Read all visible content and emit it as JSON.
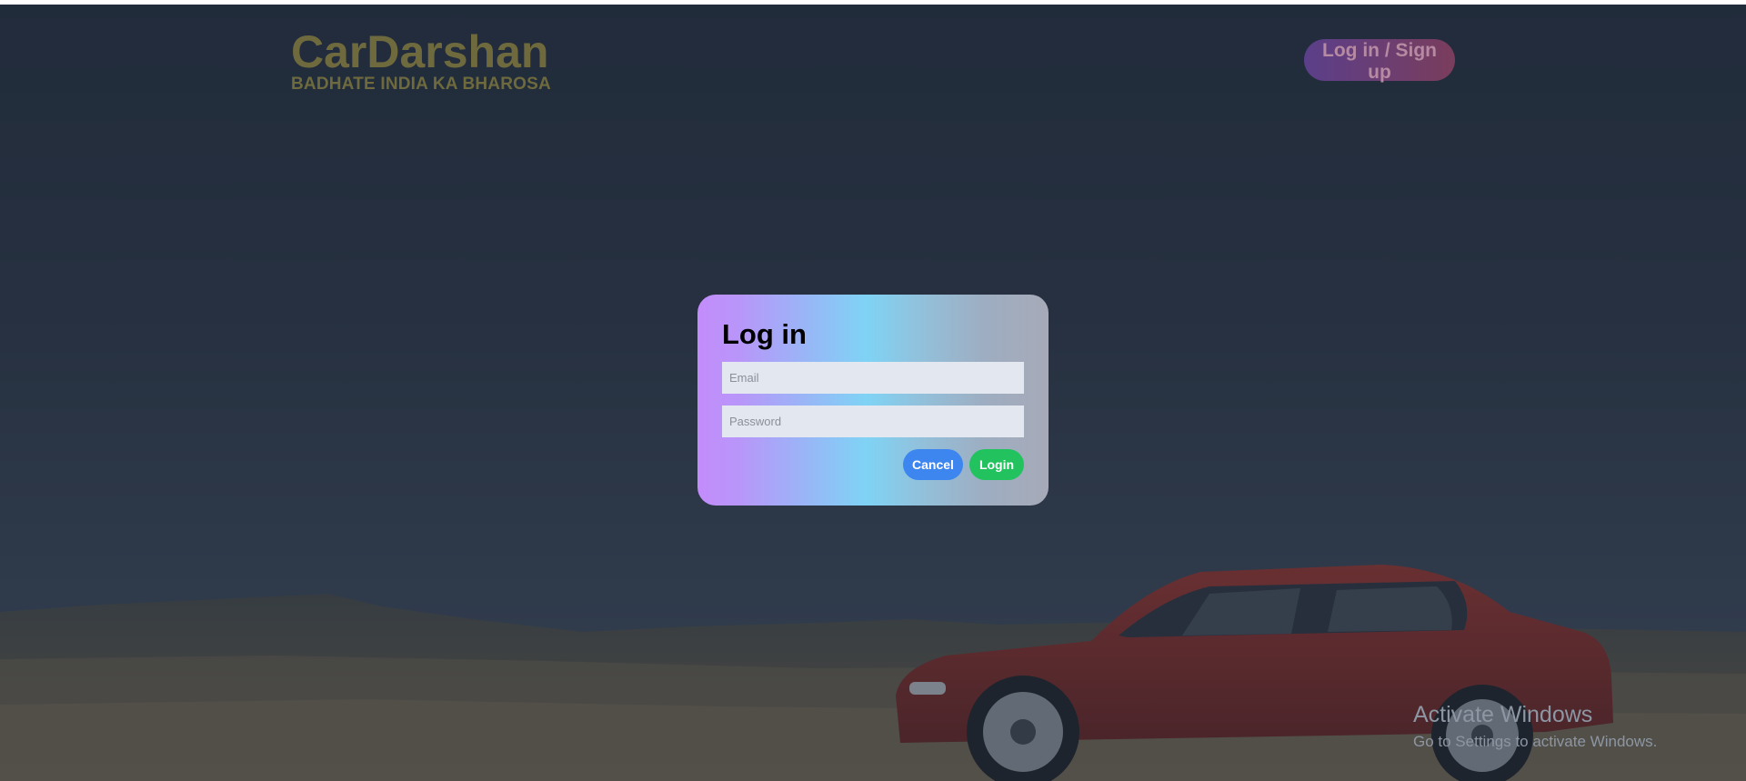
{
  "brand": {
    "title": "CarDarshan",
    "tagline": "BADHATE INDIA KA BHAROSA"
  },
  "header": {
    "auth_button_label": "Log in / Sign up"
  },
  "login_modal": {
    "title": "Log in",
    "email_placeholder": "Email",
    "password_placeholder": "Password",
    "cancel_label": "Cancel",
    "login_label": "Login"
  },
  "watermark": {
    "title": "Activate Windows",
    "subtitle": "Go to Settings to activate Windows."
  },
  "colors": {
    "brand_text": "#6e6a3e",
    "cancel_button": "#3d86f0",
    "login_button": "#22c35e",
    "car_body": "#8f2e28"
  }
}
